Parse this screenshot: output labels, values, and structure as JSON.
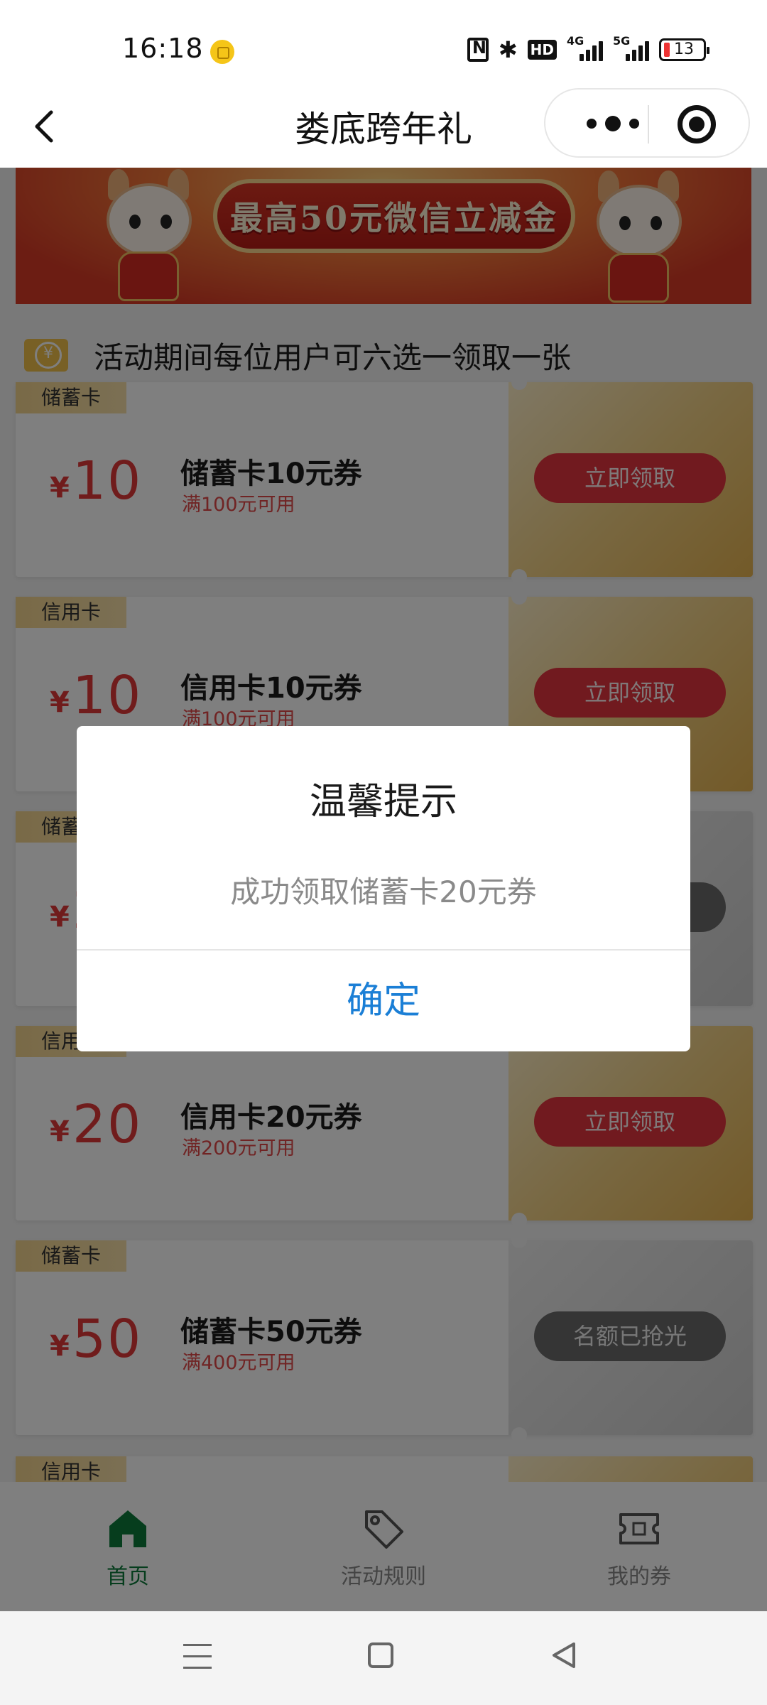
{
  "status_bar": {
    "time": "16:18",
    "network_4g": "4G",
    "network_5g": "5G",
    "hd_label": "HD",
    "battery_level": "13",
    "icons": [
      "app-notification-icon",
      "nfc-icon",
      "bluetooth-icon",
      "hd-icon",
      "signal-4g-icon",
      "signal-5g-icon",
      "battery-icon"
    ]
  },
  "nav": {
    "title": "娄底跨年礼",
    "icons": [
      "back-icon",
      "more-icon",
      "close-target-icon"
    ]
  },
  "banner": {
    "text": "最高50元微信立减金"
  },
  "notice": {
    "text": "活动期间每位用户可六选一领取一张"
  },
  "currency_symbol": "¥",
  "coupons": [
    {
      "tag": "储蓄卡",
      "amount": "10",
      "name": "储蓄卡10元券",
      "condition": "满100元可用",
      "button": "立即领取",
      "available": true
    },
    {
      "tag": "信用卡",
      "amount": "10",
      "name": "信用卡10元券",
      "condition": "满100元可用",
      "button": "立即领取",
      "available": true
    },
    {
      "tag": "储蓄卡",
      "amount": "2",
      "name": "",
      "condition": "",
      "button": "",
      "available": false
    },
    {
      "tag": "信用卡",
      "amount": "20",
      "name": "信用卡20元券",
      "condition": "满200元可用",
      "button": "立即领取",
      "available": true
    },
    {
      "tag": "储蓄卡",
      "amount": "50",
      "name": "储蓄卡50元券",
      "condition": "满400元可用",
      "button": "名额已抢光",
      "available": false
    },
    {
      "tag": "信用卡",
      "amount": "",
      "name": "",
      "condition": "",
      "button": "",
      "available": true
    }
  ],
  "tab_bar": {
    "tabs": [
      {
        "label": "首页",
        "icon": "home-icon",
        "active": true
      },
      {
        "label": "活动规则",
        "icon": "tag-icon",
        "active": false
      },
      {
        "label": "我的券",
        "icon": "coupon-icon",
        "active": false
      }
    ]
  },
  "dialog": {
    "title": "温馨提示",
    "message": "成功领取储蓄卡20元券",
    "confirm": "确定"
  },
  "system_nav": {
    "icons": [
      "menu-icon",
      "home-square-icon",
      "back-triangle-icon"
    ]
  },
  "colors": {
    "accent_green": "#0c7a3a",
    "coupon_red": "#e03838",
    "button_red": "#e3343e",
    "dialog_blue": "#1b7fd6",
    "gold": "#f2d185"
  }
}
